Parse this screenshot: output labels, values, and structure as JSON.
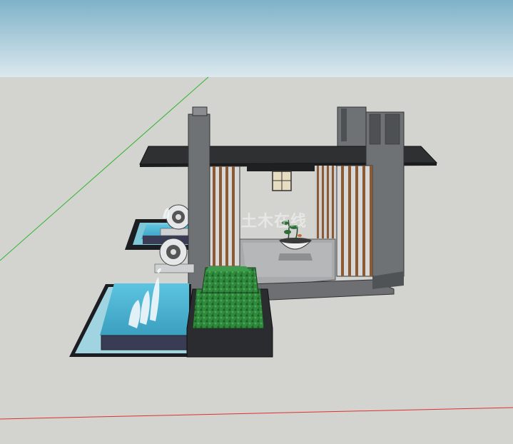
{
  "scene": {
    "kind": "3d-model-viewport",
    "description_elements": [
      "pavilion",
      "fountain-pools",
      "wheel-ornaments",
      "hedge-block",
      "bonsai-bowl",
      "lantern"
    ]
  },
  "colors": {
    "sky_top": "#7fb2c9",
    "sky_bottom": "#dbe8ee",
    "ground": "#d3d3cf",
    "green_axis": "#2fb52f",
    "red_axis": "#e03030",
    "roof": "#2f3032",
    "pillar": "#6f7275",
    "pillar_dark": "#4e5154",
    "slat": "#8a5a34",
    "floor": "#a9aaab",
    "water": "#4fb8d8",
    "pool_rim": "#222326",
    "hedge": "#2f8a3c",
    "hedge_dark": "#1e5e29",
    "plinth": "#2b2c2f"
  },
  "watermark": {
    "text": "土木在线"
  }
}
